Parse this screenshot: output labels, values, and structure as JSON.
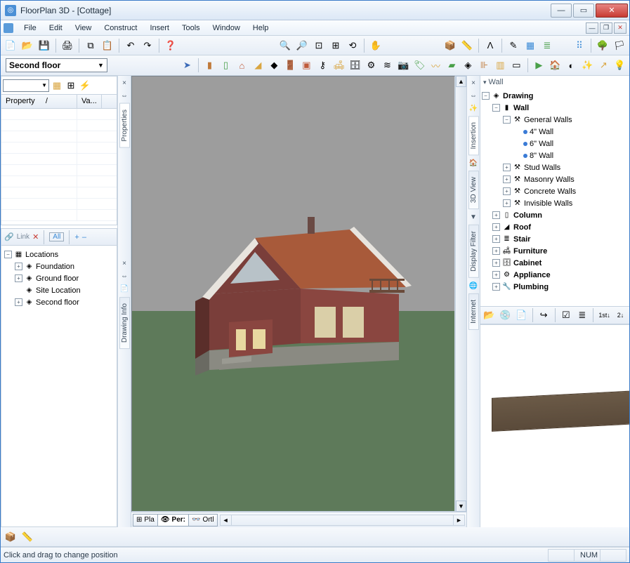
{
  "title": "FloorPlan 3D - [Cottage]",
  "menu": [
    "File",
    "Edit",
    "View",
    "Construct",
    "Insert",
    "Tools",
    "Window",
    "Help"
  ],
  "floor_selector": "Second floor",
  "property_panel": {
    "col1": "Property",
    "col2": "Va..."
  },
  "locations_bar": {
    "link": "Link",
    "all": "All",
    "plus": "+",
    "minus": "–"
  },
  "locations": {
    "root": "Locations",
    "items": [
      "Foundation",
      "Ground floor",
      "Site Location",
      "Second floor"
    ]
  },
  "view_tabs": {
    "plan": "Pla",
    "persp": "Per:",
    "ortho": "Ortl"
  },
  "side_tabs_left": [
    "Properties",
    "Drawing Info"
  ],
  "side_tabs_right": [
    "Insertion",
    "3D View",
    "Display Filter",
    "Internet"
  ],
  "right_header": "Wall",
  "tree": {
    "root": "Drawing",
    "wall": "Wall",
    "general": "General Walls",
    "wall_sizes": [
      "4\" Wall",
      "6\" Wall",
      "8\" Wall"
    ],
    "wall_groups": [
      "Stud Walls",
      "Masonry Walls",
      "Concrete Walls",
      "Invisible Walls"
    ],
    "cats": [
      "Column",
      "Roof",
      "Stair",
      "Furniture",
      "Cabinet",
      "Appliance",
      "Plumbing"
    ]
  },
  "status": {
    "hint": "Click and drag to change position",
    "num": "NUM"
  }
}
